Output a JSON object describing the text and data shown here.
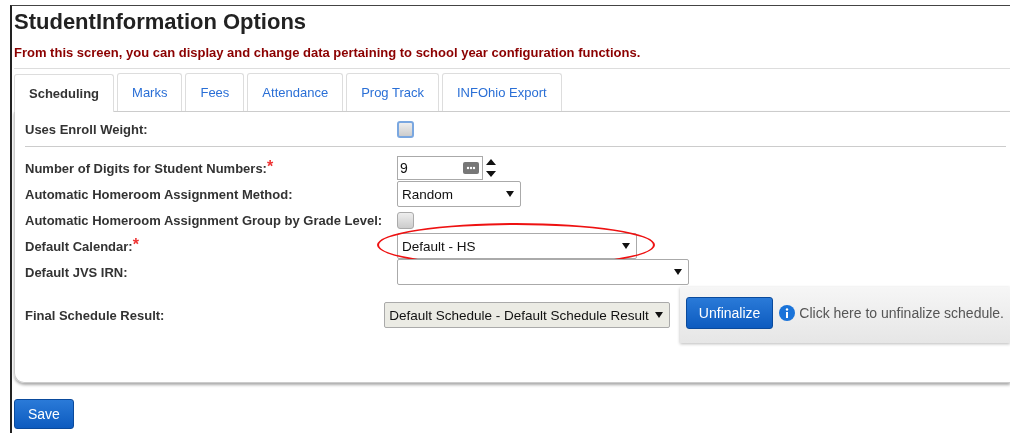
{
  "title": "StudentInformation Options",
  "subtitle": "From this screen, you can display and change data pertaining to school year configuration functions.",
  "tabs": [
    {
      "label": "Scheduling",
      "selected": true
    },
    {
      "label": "Marks",
      "selected": false
    },
    {
      "label": "Fees",
      "selected": false
    },
    {
      "label": "Attendance",
      "selected": false
    },
    {
      "label": "Prog Track",
      "selected": false
    },
    {
      "label": "INFOhio Export",
      "selected": false
    }
  ],
  "fields": [
    {
      "label": "Uses Enroll Weight:",
      "kind": "checkbox",
      "checked": false
    },
    {
      "label": "Number of Digits for Student Numbers:",
      "kind": "spinner",
      "required_mark": "*",
      "value": "9"
    },
    {
      "label": "Automatic Homeroom Assignment Method:",
      "kind": "select",
      "value": "Random",
      "disabled": false,
      "circled": false
    },
    {
      "label": "Automatic Homeroom Assignment Group by Grade Level:",
      "kind": "checkbox",
      "checked": false
    },
    {
      "label": "Default Calendar:",
      "kind": "select",
      "required_mark": "*",
      "value": "Default - HS",
      "disabled": false,
      "circled": true
    },
    {
      "label": "Default JVS IRN:",
      "kind": "select",
      "disabled": false,
      "circled": false
    },
    {
      "label": "Final Schedule Result:",
      "kind": "select",
      "value": "Default Schedule - Default Schedule Result",
      "disabled": true,
      "circled": false,
      "action": {
        "button": "Unfinalize",
        "hint": "Click here to unfinalize schedule."
      }
    }
  ],
  "save_button": "Save"
}
